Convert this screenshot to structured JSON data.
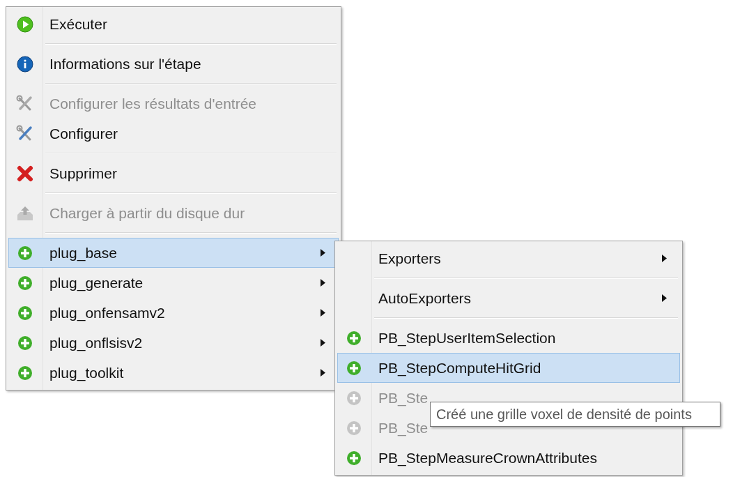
{
  "menu": {
    "groups": [
      [
        {
          "kind": "run",
          "label": "Exécuter",
          "disabled": false,
          "selected": false,
          "has_submenu": false
        }
      ],
      [
        {
          "kind": "info",
          "label": "Informations sur l'étape",
          "disabled": false,
          "selected": false,
          "has_submenu": false
        }
      ],
      [
        {
          "kind": "configure",
          "label": "Configurer les résultats d'entrée",
          "disabled": true,
          "selected": false,
          "has_submenu": false
        },
        {
          "kind": "configure",
          "label": "Configurer",
          "disabled": false,
          "selected": false,
          "has_submenu": false
        }
      ],
      [
        {
          "kind": "delete",
          "label": "Supprimer",
          "disabled": false,
          "selected": false,
          "has_submenu": false
        }
      ],
      [
        {
          "kind": "load",
          "label": "Charger à partir du disque dur",
          "disabled": true,
          "selected": false,
          "has_submenu": false
        }
      ],
      [
        {
          "kind": "plugin",
          "label": "plug_base",
          "disabled": false,
          "selected": true,
          "has_submenu": true
        },
        {
          "kind": "plugin",
          "label": "plug_generate",
          "disabled": false,
          "selected": false,
          "has_submenu": true
        },
        {
          "kind": "plugin",
          "label": "plug_onfensamv2",
          "disabled": false,
          "selected": false,
          "has_submenu": true
        },
        {
          "kind": "plugin",
          "label": "plug_onflsisv2",
          "disabled": false,
          "selected": false,
          "has_submenu": true
        },
        {
          "kind": "plugin",
          "label": "plug_toolkit",
          "disabled": false,
          "selected": false,
          "has_submenu": true
        }
      ]
    ]
  },
  "submenu": {
    "groups": [
      [
        {
          "kind": "folder",
          "label": "Exporters",
          "disabled": false,
          "selected": false,
          "has_submenu": true
        }
      ],
      [
        {
          "kind": "folder",
          "label": "AutoExporters",
          "disabled": false,
          "selected": false,
          "has_submenu": true
        }
      ],
      [
        {
          "kind": "plugin",
          "label": "PB_StepUserItemSelection",
          "disabled": false,
          "selected": false,
          "has_submenu": false
        },
        {
          "kind": "plugin",
          "label": "PB_StepComputeHitGrid",
          "disabled": false,
          "selected": true,
          "has_submenu": false
        },
        {
          "kind": "plugin",
          "label": "PB_Ste",
          "disabled": true,
          "selected": false,
          "has_submenu": false
        },
        {
          "kind": "plugin",
          "label": "PB_Ste",
          "disabled": true,
          "selected": false,
          "has_submenu": false
        },
        {
          "kind": "plugin",
          "label": "PB_StepMeasureCrownAttributes",
          "disabled": false,
          "selected": false,
          "has_submenu": false
        }
      ]
    ]
  },
  "tooltip": {
    "text": "Créé une grille voxel de densité de points"
  }
}
